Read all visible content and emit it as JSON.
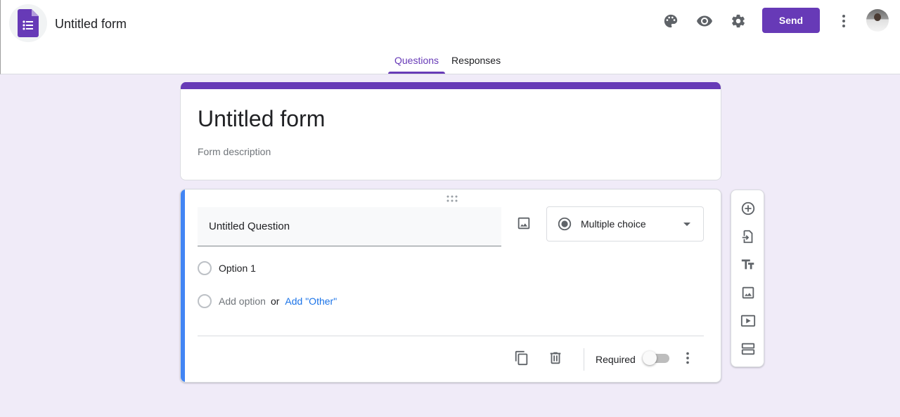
{
  "app": {
    "doc_title": "Untitled form",
    "send_label": "Send",
    "logo_icon": "google-forms-icon",
    "accent_color": "#673ab7",
    "toolbar_icons": [
      "palette-icon",
      "preview-eye-icon",
      "settings-gear-icon",
      "more-vert-icon"
    ]
  },
  "tabs": [
    {
      "label": "Questions",
      "active": true
    },
    {
      "label": "Responses",
      "active": false
    }
  ],
  "form": {
    "title": "Untitled form",
    "description_placeholder": "Form description"
  },
  "question": {
    "title": "Untitled Question",
    "type_label": "Multiple choice",
    "type_icon": "radio-button-icon",
    "options": [
      "Option 1"
    ],
    "add_option_label": "Add option",
    "or_label": "or",
    "add_other_label": "Add \"Other\"",
    "required_label": "Required",
    "required": false,
    "accent_color": "#4285f4"
  },
  "side_toolbar": {
    "icons": [
      "add-question-icon",
      "import-questions-icon",
      "add-title-icon",
      "add-image-icon",
      "add-video-icon",
      "add-section-icon"
    ]
  }
}
